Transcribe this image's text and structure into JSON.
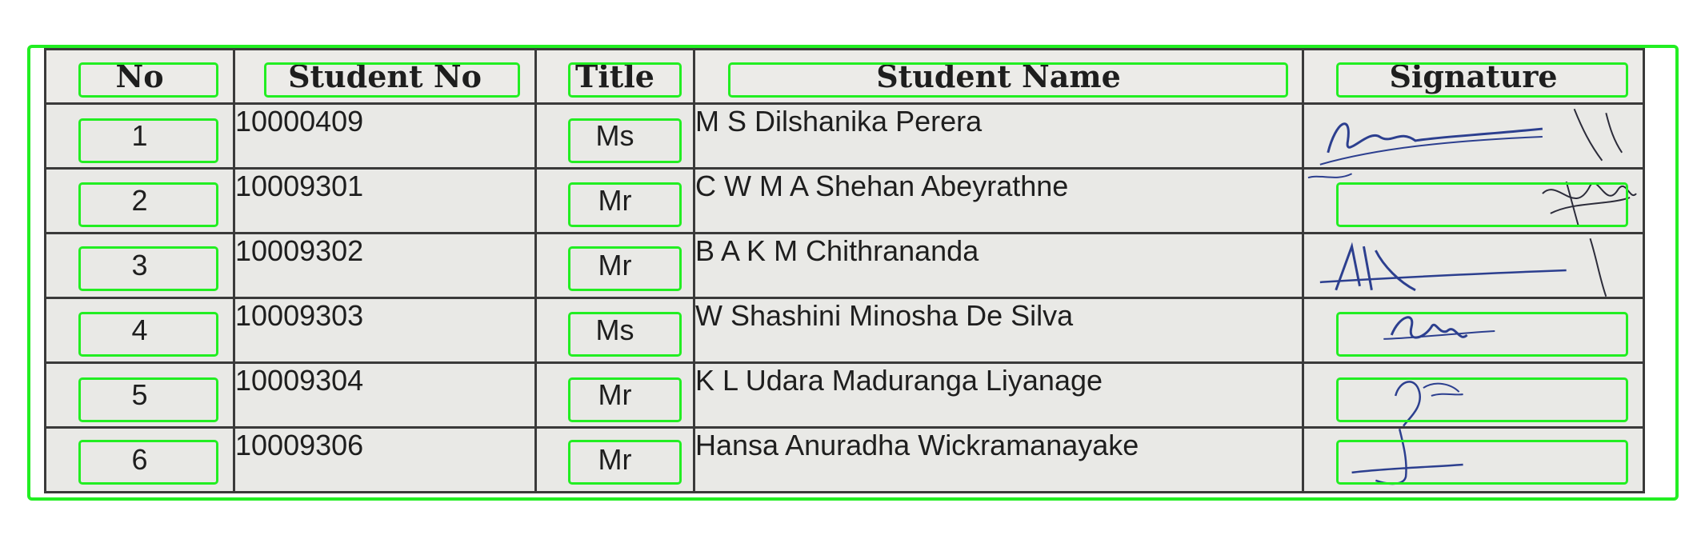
{
  "table": {
    "headers": {
      "no": "No",
      "student_no": "Student No",
      "title": "Title",
      "student_name": "Student Name",
      "signature": "Signature"
    },
    "rows": [
      {
        "no": "1",
        "student_no": "10000409",
        "title": "Ms",
        "student_name": "M S Dilshanika  Perera"
      },
      {
        "no": "2",
        "student_no": "10009301",
        "title": "Mr",
        "student_name": "C W M  A Shehan Abeyrathne"
      },
      {
        "no": "3",
        "student_no": "10009302",
        "title": "Mr",
        "student_name": "B A K M  Chithrananda"
      },
      {
        "no": "4",
        "student_no": "10009303",
        "title": "Ms",
        "student_name": "W Shashini Minosha  De Silva"
      },
      {
        "no": "5",
        "student_no": "10009304",
        "title": "Mr",
        "student_name": "K L Udara Maduranga  Liyanage"
      },
      {
        "no": "6",
        "student_no": "10009306",
        "title": "Mr",
        "student_name": "Hansa Anuradha  Wickramanayake"
      }
    ]
  },
  "colors": {
    "ink": "#1e1e1e",
    "signature_ink": "#2c3f8f",
    "annotation_outline": "#22ee22",
    "paper": "#e9e9e6"
  }
}
